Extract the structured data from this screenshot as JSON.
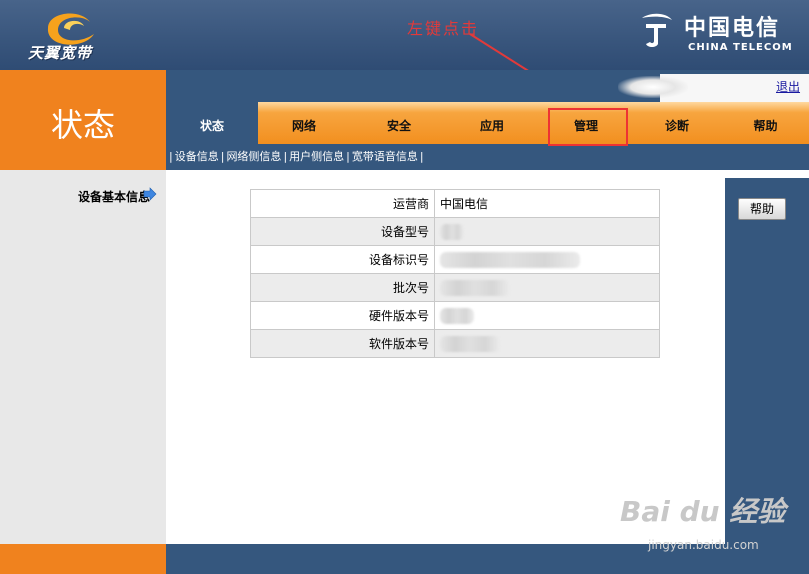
{
  "header": {
    "logo_text": "天翼宽带",
    "brand_cn": "中国电信",
    "brand_en": "CHINA TELECOM",
    "annotation": "左键点击",
    "logout_label": "退出"
  },
  "page_title": "状态",
  "tabs": [
    {
      "label": "状态",
      "active": true
    },
    {
      "label": "网络"
    },
    {
      "label": "安全"
    },
    {
      "label": "应用"
    },
    {
      "label": "管理",
      "highlighted": true
    },
    {
      "label": "诊断"
    },
    {
      "label": "帮助"
    }
  ],
  "subnav": [
    "设备信息",
    "网络侧信息",
    "用户侧信息",
    "宽带语音信息"
  ],
  "sidebar": {
    "label": "设备基本信息"
  },
  "device_info": [
    {
      "label": "运营商",
      "value": "中国电信"
    },
    {
      "label": "设备型号",
      "value": ""
    },
    {
      "label": "设备标识号",
      "value": ""
    },
    {
      "label": "批次号",
      "value": ""
    },
    {
      "label": "硬件版本号",
      "value": ""
    },
    {
      "label": "软件版本号",
      "value": ""
    }
  ],
  "help_button": "帮助",
  "watermark": {
    "main": "Bai du 经验",
    "sub": "jingyan.baidu.com"
  },
  "colors": {
    "orange": "#f0821e",
    "navy": "#35577e",
    "highlight": "#e33333"
  }
}
